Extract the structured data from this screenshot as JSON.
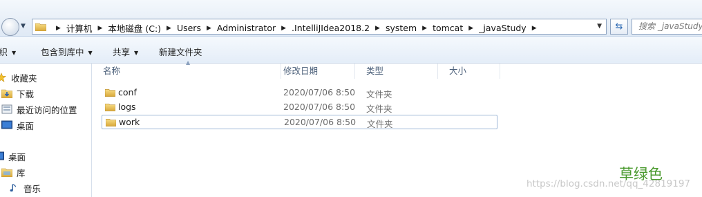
{
  "address": {
    "crumbs": [
      "计算机",
      "本地磁盘 (C:)",
      "Users",
      "Administrator",
      ".IntelliJIdea2018.2",
      "system",
      "tomcat",
      "_javaStudy"
    ],
    "search_placeholder": "搜索 _javaStudy"
  },
  "toolbar": {
    "organize": "组织",
    "include_in_library": "包含到库中",
    "share": "共享",
    "new_folder": "新建文件夹"
  },
  "nav": {
    "favorites": "收藏夹",
    "downloads": "下载",
    "recent": "最近访问的位置",
    "desktop_fav": "桌面",
    "desktop": "桌面",
    "libraries": "库",
    "music": "音乐"
  },
  "columns": {
    "name": "名称",
    "modified": "修改日期",
    "type": "类型",
    "size": "大小"
  },
  "files": [
    {
      "name": "conf",
      "modified": "2020/07/06 8:50",
      "type": "文件夹",
      "selected": false
    },
    {
      "name": "logs",
      "modified": "2020/07/06 8:50",
      "type": "文件夹",
      "selected": false
    },
    {
      "name": "work",
      "modified": "2020/07/06 8:50",
      "type": "文件夹",
      "selected": true
    }
  ],
  "annotation": {
    "caption": "草绿色",
    "watermark": "https://blog.csdn.net/qq_42819197"
  },
  "colors": {
    "folder": "#e8c15a",
    "caption": "#4a9a2e",
    "selection_border": "#9db7d6"
  },
  "icons": [
    "back-icon",
    "folder-icon",
    "refresh-icon",
    "star-icon",
    "download-icon",
    "recent-places-icon",
    "desktop-icon",
    "library-icon",
    "music-icon"
  ]
}
